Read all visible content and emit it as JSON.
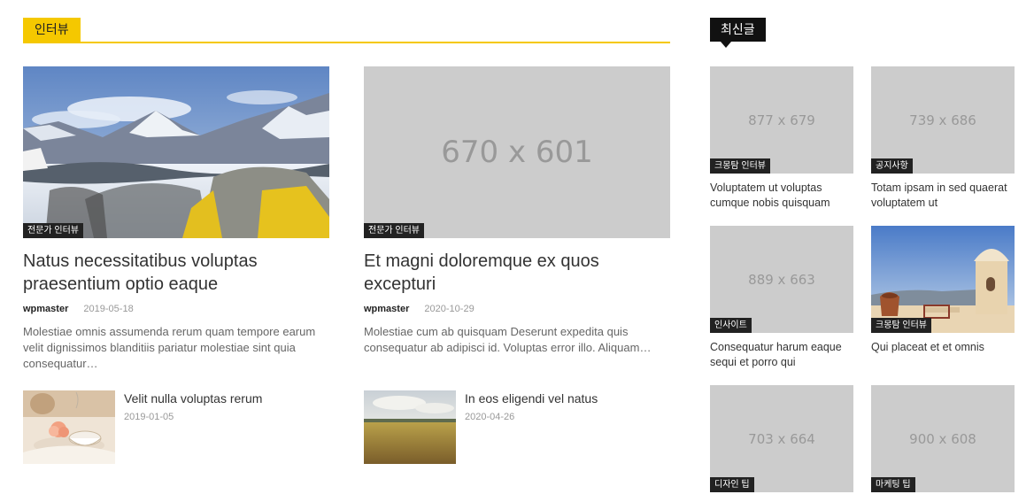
{
  "sections": {
    "interview_title": "인터뷰",
    "recent_title": "최신글"
  },
  "featured": [
    {
      "category": "전문가 인터뷰",
      "title": "Natus necessitatibus voluptas praesentium optio eaque",
      "author": "wpmaster",
      "date": "2019-05-18",
      "excerpt": "Molestiae omnis assumenda rerum quam tempore earum velit dignissimos blanditiis pariatur molestiae sint quia consequatur…"
    },
    {
      "category": "전문가 인터뷰",
      "placeholder": "670 x 601",
      "title": "Et magni doloremque ex quos excepturi",
      "author": "wpmaster",
      "date": "2020-10-29",
      "excerpt": "Molestiae cum ab quisquam Deserunt expedita quis consequatur ab adipisci id. Voluptas error illo. Aliquam…"
    }
  ],
  "small_posts": [
    {
      "title": "Velit nulla voluptas rerum",
      "date": "2019-01-05"
    },
    {
      "title": "In eos eligendi vel natus",
      "date": "2020-04-26"
    }
  ],
  "recent": [
    {
      "placeholder": "877 x 679",
      "category": "크몽탐 인터뷰",
      "title": "Voluptatem ut voluptas cumque nobis quisquam"
    },
    {
      "placeholder": "739 x 686",
      "category": "공지사항",
      "title": "Totam ipsam in sed quaerat voluptatem ut"
    },
    {
      "placeholder": "889 x 663",
      "category": "인사이트",
      "title": "Consequatur harum eaque sequi et porro qui"
    },
    {
      "category": "크몽탐 인터뷰",
      "title": "Qui placeat et et omnis"
    },
    {
      "placeholder": "703 x 664",
      "category": "디자인 팁",
      "title": ""
    },
    {
      "placeholder": "900 x 608",
      "category": "마케팅 팁",
      "title": ""
    }
  ]
}
